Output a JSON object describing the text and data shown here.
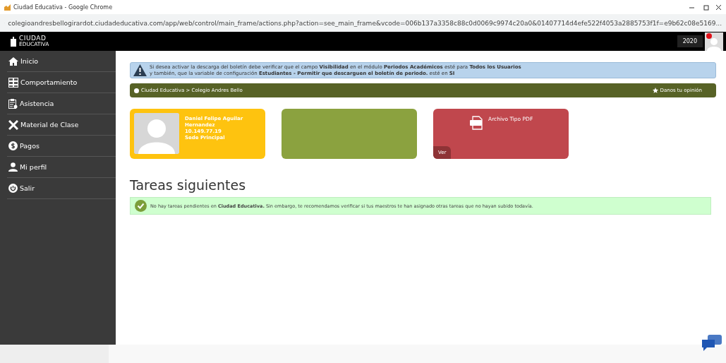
{
  "window": {
    "title": "Ciudad Educativa - Google Chrome",
    "url": "colegioandresbellogirardot.ciudadeducativa.com/app/web/control/main_frame/actions.php?action=see_main_frame&vcode=006b137a3358c88c0d0069c9974c20a0&01407714d4efe522f4053a2885753f1f=e9b62c08e5169..."
  },
  "header": {
    "logo_main": "CIUDAD",
    "logo_sub": "EDUCATIVA",
    "year": "2020"
  },
  "sidebar": {
    "items": [
      {
        "label": "Inicio"
      },
      {
        "label": "Comportamiento"
      },
      {
        "label": "Asistencia"
      },
      {
        "label": "Material de Clase"
      },
      {
        "label": "Pagos"
      },
      {
        "label": "Mi perfil"
      },
      {
        "label": "Salir"
      }
    ]
  },
  "alert": {
    "lines": [
      "Si desea activar la descarga del boletín debe verificar que el campo **Visibilidad** en el módulo **Periodos Académicos** esté para **Todos los Usuarios**",
      "y también, que la variable de configuración **Estudiantes - Permitir que descarguen el boletín de periodo.** esté en **SI**"
    ]
  },
  "breadcrumb": {
    "path": "Ciudad Educativa > Colegio Andres Bello",
    "feedback": "Danos tu opinión"
  },
  "cards": [
    {
      "kind": "profile",
      "color": "#fec30f",
      "lines": [
        "Daniel Felipe Aguilar",
        "Hernandez",
        "10.149.77.19",
        "Sede Principal"
      ]
    },
    {
      "kind": "blank",
      "color": "#8ba23f"
    },
    {
      "kind": "file",
      "color": "#c0474d",
      "title": "Archivo Tipo PDF",
      "action": "Ver"
    }
  ],
  "section_title": "Tareas siguientes",
  "notice": "No hay tareas pendientes en **Ciudad Educativa.** Sin embargo, te recomendamos verificar si tus maestros te han asignado otras tareas que no hayan subido todavía."
}
